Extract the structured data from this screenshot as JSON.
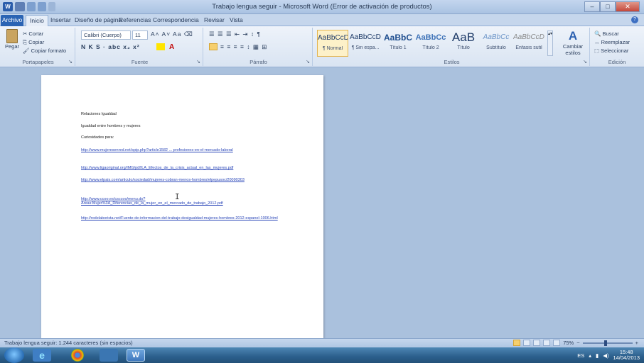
{
  "window": {
    "title": "Trabajo lengua seguir - Microsoft Word (Error de activación de productos)",
    "minimize": "–",
    "maximize": "□",
    "close": "✕"
  },
  "qat": {
    "word_glyph": "W"
  },
  "tabs": [
    "Archivo",
    "Inicio",
    "Insertar",
    "Diseño de página",
    "Referencias",
    "Correspondencia",
    "Revisar",
    "Vista"
  ],
  "ribbon": {
    "clipboard": {
      "paste": "Pegar",
      "cut": "Cortar",
      "copy": "Copiar",
      "format_painter": "Copiar formato",
      "label": "Portapapeles"
    },
    "font": {
      "font_name": "Calibri (Cuerpo)",
      "font_size": "11",
      "row1_icons": "A˄ A˅  Aa  ⌫",
      "row2_icons": "N K S · abc x₂ x²",
      "label": "Fuente"
    },
    "paragraph": {
      "row1_icons": "☰ ☰ ☰  ⇤ ⇥  ↕  ¶",
      "row2_icons": "≡ ≡ ≡ ≡  ↕  ▦  ⊞",
      "label": "Párrafo"
    },
    "styles": {
      "items": [
        {
          "sample": "AaBbCcDc",
          "name": "¶ Normal"
        },
        {
          "sample": "AaBbCcDc",
          "name": "¶ Sin espa..."
        },
        {
          "sample": "AaBbC",
          "name": "Título 1"
        },
        {
          "sample": "AaBbCc",
          "name": "Título 2"
        },
        {
          "sample": "AaB",
          "name": "Título"
        },
        {
          "sample": "AaBbCc",
          "name": "Subtítulo"
        },
        {
          "sample": "AaBbCcDc",
          "name": "Énfasis sutil"
        }
      ],
      "change_styles": "Cambiar estilos",
      "label": "Estilos"
    },
    "editing": {
      "find": "Buscar",
      "replace": "Reemplazar",
      "select": "Seleccionar",
      "label": "Edición"
    }
  },
  "document": {
    "lines": [
      "Relaciones Igualdad",
      "Igualdad entre hombres y mujeres",
      "Curiosidades para:"
    ],
    "links": [
      "http://www.mujeresenred.net/spip.php?article1582 ... profesiones-en-el-mercado-laboral",
      "http://www.ligaoriginal.org/IMG/pdf/LA_Efectos_de_la_crisis_actual_en_las_mujeres.pdf",
      "http://www.elpais.com/articulo/sociedad/mujeres-cobran-menos-hombres/elpepusoc/20090303",
      "http://www.ccoo.es/csccoo/menu.do?Areas:Mujer%3A_Diferencias_de_la_mujer_en_el_mercado_de_trabajo_2012.pdf",
      "http://rodelaborista.net/Fuente-de-informacion-del-trabajo-desigualdad-mujeres-hombres-2012-espanol-1006.html"
    ]
  },
  "status": {
    "left": "Trabajo lengua seguir: 1.244 caracteres (sin espacios)",
    "zoom": "75%",
    "zoom_minus": "−",
    "zoom_plus": "+"
  },
  "taskbar": {
    "ie_glyph": "e",
    "word_glyph": "W",
    "lang": "ES",
    "time": "15:48",
    "date": "14/04/2013"
  }
}
